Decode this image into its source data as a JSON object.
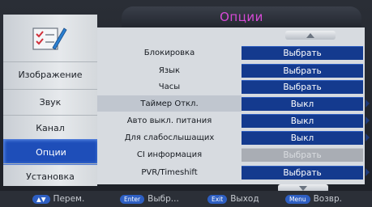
{
  "title": "Опции",
  "sidebar": {
    "items": [
      {
        "label": "Изображение"
      },
      {
        "label": "Звук"
      },
      {
        "label": "Канал"
      },
      {
        "label": "Опции"
      },
      {
        "label": "Установка"
      }
    ]
  },
  "options": [
    {
      "label": "Блокировка",
      "value": "Выбрать"
    },
    {
      "label": "Язык",
      "value": "Выбрать"
    },
    {
      "label": "Часы",
      "value": "Выбрать"
    },
    {
      "label": "Таймер Откл.",
      "value": "Выкл"
    },
    {
      "label": "Авто выкл. питания",
      "value": "Выкл"
    },
    {
      "label": "Для слабослышащих",
      "value": "Выкл"
    },
    {
      "label": "CI информация",
      "value": "Выбрать"
    },
    {
      "label": "PVR/Timeshift",
      "value": "Выбрать"
    }
  ],
  "footer": {
    "move_key": "▲▼",
    "move_label": "Перем.",
    "enter_key": "Enter",
    "enter_label": "Выбр...",
    "exit_key": "Exit",
    "exit_label": "Выход",
    "menu_key": "Menu",
    "menu_label": "Возвр."
  },
  "colors": {
    "title": "#d74ad7",
    "active_tab": "#1e4eb9",
    "value_box": "#143a8e",
    "disabled_box": "#a9adb4"
  }
}
